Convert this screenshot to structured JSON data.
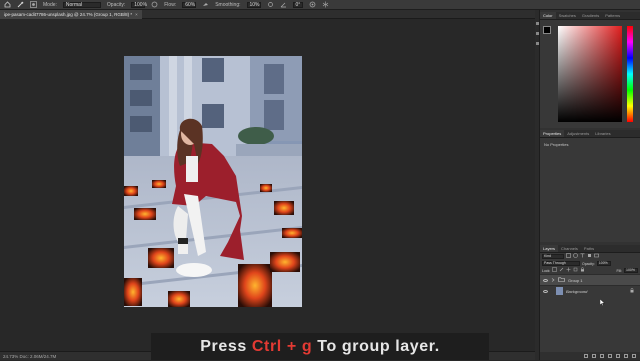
{
  "options_bar": {
    "mode_label": "Mode:",
    "mode_value": "Normal",
    "opacity_label": "Opacity:",
    "opacity_value": "100%",
    "flow_label": "Flow:",
    "flow_value": "60%",
    "smoothing_label": "Smoothing:",
    "smoothing_value": "10%",
    "angle_value": "0°"
  },
  "document": {
    "tab_title": "ipe-pasam-cadit7786-unsplash.jpg @ 24.7% (Group 1, RGB/8) *",
    "status_text": "24.73%   Doc: 2.06M/24.7M"
  },
  "caption": {
    "prefix": "Press ",
    "shortcut": "Ctrl + g",
    "suffix": "  To group layer."
  },
  "color_panel": {
    "tabs": [
      "Color",
      "Swatches",
      "Gradients",
      "Patterns"
    ],
    "field_color": "#e01e1e"
  },
  "properties_panel": {
    "tabs": [
      "Properties",
      "Adjustments",
      "Libraries"
    ],
    "empty_text": "No Properties"
  },
  "layers_panel": {
    "tabs": [
      "Layers",
      "Channels",
      "Paths"
    ],
    "filter_label": "Kind",
    "blend_mode": "Pass Through",
    "opacity_label": "Opacity:",
    "opacity_value": "100%",
    "lock_label": "Lock:",
    "fill_label": "Fill:",
    "fill_value": "100%",
    "layers": [
      {
        "name": "Group 1",
        "type": "group"
      },
      {
        "name": "Background",
        "type": "pixel"
      }
    ]
  }
}
